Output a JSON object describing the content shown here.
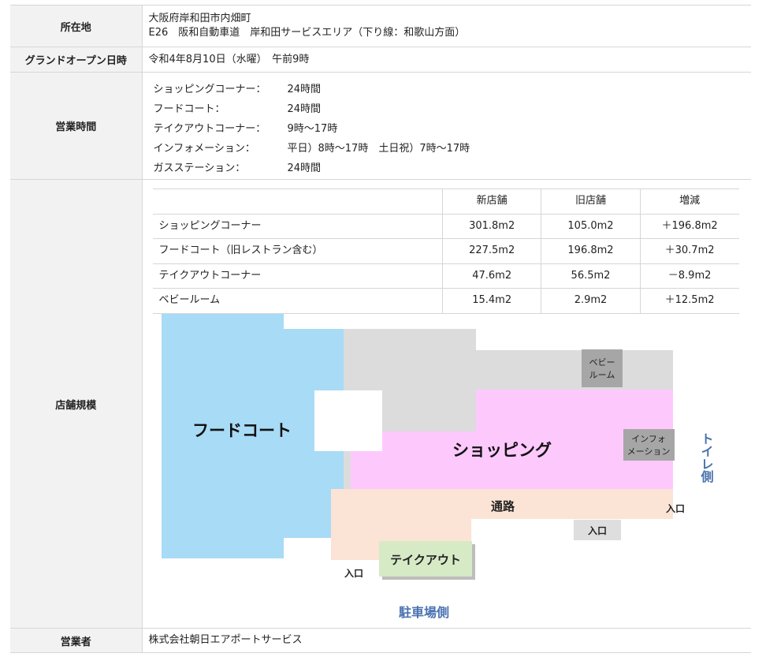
{
  "rows": {
    "location": {
      "label": "所在地",
      "line1": "大阪府岸和田市内畑町",
      "line2": "E26　阪和自動車道　岸和田サービスエリア（下り線：和歌山方面）"
    },
    "grand_open": {
      "label": "グランドオープン日時",
      "value": "令和4年8月10日（水曜）　午前9時"
    },
    "hours": {
      "label": "営業時間",
      "items": [
        {
          "name": "ショッピングコーナー：",
          "value": "24時間"
        },
        {
          "name": "フードコート：",
          "value": "24時間"
        },
        {
          "name": "テイクアウトコーナー：",
          "value": "9時～17時"
        },
        {
          "name": "インフォメーション：",
          "value": "平日）8時～17時　土日祝）7時～17時"
        },
        {
          "name": "ガスステーション：",
          "value": "24時間"
        }
      ]
    },
    "store_size": {
      "label": "店舗規模",
      "headers": [
        "",
        "新店舗",
        "旧店舗",
        "増減"
      ],
      "table": [
        [
          "ショッピングコーナー",
          "301.8m2",
          "105.0m2",
          "＋196.8m2"
        ],
        [
          "フードコート（旧レストラン含む）",
          "227.5m2",
          "196.8m2",
          "＋30.7m2"
        ],
        [
          "テイクアウトコーナー",
          "47.6m2",
          "56.5m2",
          "－8.9m2"
        ],
        [
          "ベビールーム",
          "15.4m2",
          "2.9m2",
          "＋12.5m2"
        ]
      ]
    },
    "operator": {
      "label": "営業者",
      "value": "株式会社朝日エアポートサービス"
    }
  },
  "map": {
    "food_court": "フードコート",
    "shopping": "ショッピング",
    "passage": "通路",
    "takeout": "テイクアウト",
    "baby_room_1": "ベビー",
    "baby_room_2": "ルーム",
    "info_1": "インフォ",
    "info_2": "メーション",
    "entrance_right": "入口",
    "entrance_mid": "入口",
    "entrance_left": "入口",
    "toilet_side": "トイレ側",
    "parking_side": "駐車場側",
    "colors": {
      "food_court": "#a8dbf6",
      "shopping": "#fdc9fd",
      "grey_area": "#dcdcdc",
      "passage": "#fbe3d6",
      "takeout": "#d6eac6",
      "small_room": "#a6a6a6",
      "side_label": "#4a72b0"
    }
  }
}
